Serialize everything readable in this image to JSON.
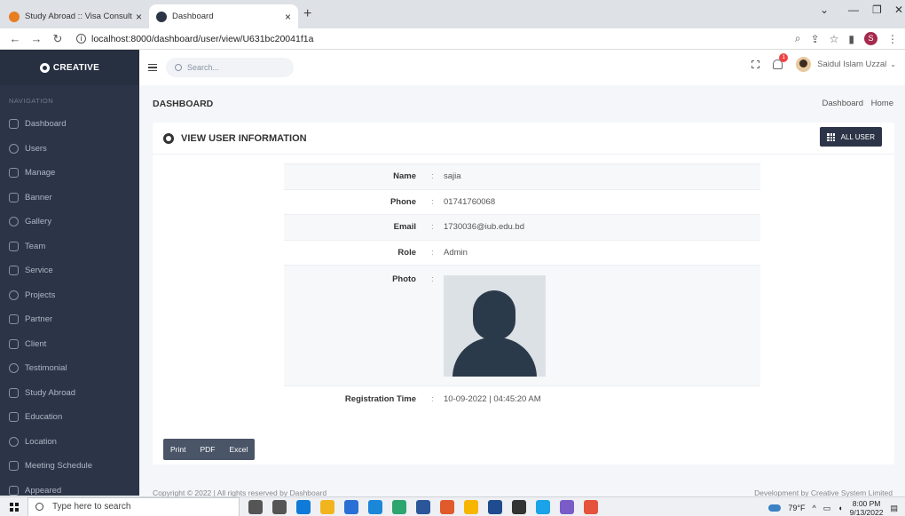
{
  "browser": {
    "tabs": [
      {
        "title": "Study Abroad :: Visa Consultancy",
        "active": false,
        "favicon_color": "#e67e22"
      },
      {
        "title": "Dashboard",
        "active": true,
        "favicon_color": "#2c3547"
      }
    ],
    "url": "localhost:8000/dashboard/user/view/U631bc20041f1a",
    "profile_initial": "S"
  },
  "brand": {
    "name": "CREATIVE"
  },
  "sidebar": {
    "heading": "NAVIGATION",
    "items": [
      {
        "label": "Dashboard",
        "icon": "home-icon"
      },
      {
        "label": "Users",
        "icon": "user-icon"
      },
      {
        "label": "Manage",
        "icon": "gear-icon"
      },
      {
        "label": "Banner",
        "icon": "banner-icon"
      },
      {
        "label": "Gallery",
        "icon": "gallery-icon"
      },
      {
        "label": "Team",
        "icon": "team-icon"
      },
      {
        "label": "Service",
        "icon": "plus-circle-icon"
      },
      {
        "label": "Projects",
        "icon": "layers-icon"
      },
      {
        "label": "Partner",
        "icon": "partner-icon"
      },
      {
        "label": "Client",
        "icon": "target-icon"
      },
      {
        "label": "Testimonial",
        "icon": "inbox-icon"
      },
      {
        "label": "Study Abroad",
        "icon": "plane-icon"
      },
      {
        "label": "Education",
        "icon": "book-icon"
      },
      {
        "label": "Location",
        "icon": "map-icon"
      },
      {
        "label": "Meeting Schedule",
        "icon": "calendar-icon"
      },
      {
        "label": "Appeared",
        "icon": "file-icon"
      }
    ]
  },
  "topbar": {
    "search_placeholder": "Search...",
    "notification_count": "1",
    "user_name": "Saidul Islam Uzzal"
  },
  "page": {
    "title": "DASHBOARD",
    "breadcrumb": [
      "Dashboard",
      "Home"
    ]
  },
  "card": {
    "title": "VIEW USER INFORMATION",
    "all_user_label": "ALL USER"
  },
  "user_info": [
    {
      "label": "Name",
      "value": "sajia"
    },
    {
      "label": "Phone",
      "value": "01741760068"
    },
    {
      "label": "Email",
      "value": "1730036@iub.edu.bd"
    },
    {
      "label": "Role",
      "value": "Admin"
    },
    {
      "label": "Photo",
      "value": ""
    },
    {
      "label": "Registration Time",
      "value": "10-09-2022 | 04:45:20 AM"
    }
  ],
  "separator": ":",
  "export_buttons": [
    "Print",
    "PDF",
    "Excel"
  ],
  "footer": {
    "left": "Copyright © 2022 | All rights reserved by Dashboard",
    "right": "Development by Creative System Limited"
  },
  "taskbar": {
    "search_placeholder": "Type here to search",
    "weather": "79°F",
    "time": "8:00 PM",
    "date": "9/13/2022",
    "app_colors": [
      "#555555",
      "#555555",
      "#0f7ad8",
      "#f2b41d",
      "#2a6fd6",
      "#1c87d9",
      "#2ca56f",
      "#2b579a",
      "#e05a2b",
      "#f7b500",
      "#1f4b8f",
      "#333333",
      "#1aa3e8",
      "#7a5cc9",
      "#e5533c"
    ]
  }
}
